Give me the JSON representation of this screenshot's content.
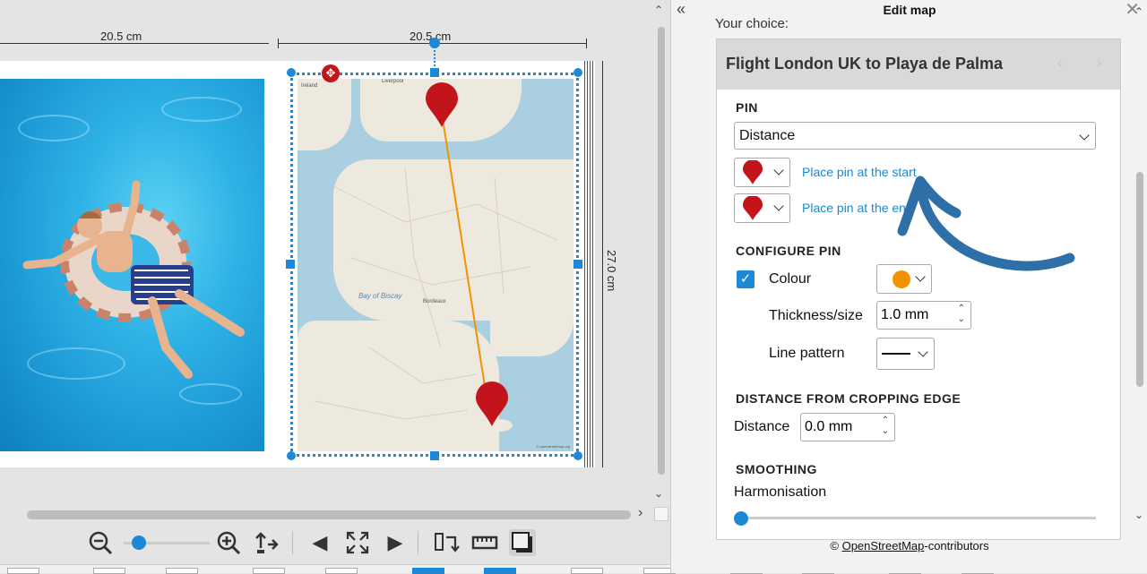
{
  "canvas": {
    "dim_left": "20.5 cm",
    "dim_right": "20.5 cm",
    "dim_height": "27.0 cm",
    "map_labels": [
      "Ireland",
      "Liverpool",
      "Bay of Biscay",
      "Bordeaux"
    ],
    "attribution_small": "© openstreetmap.org"
  },
  "toolbar": {
    "icons": [
      "zoom-out-icon",
      "zoom-in-icon",
      "fit-icon",
      "prev-page-icon",
      "fullscreen-icon",
      "next-page-icon",
      "swap-pages-icon",
      "ruler-icon",
      "shadow-icon"
    ],
    "zoom_level": 0.1
  },
  "panel": {
    "title": "Edit map",
    "collapse_icon": "double-chevron-left-icon",
    "close_icon": "close-icon",
    "your_choice": "Your choice:",
    "card_title": "Flight London UK to Playa de Palma",
    "pin_section": "PIN",
    "pin_mode": "Distance",
    "pin_start_link": "Place pin at the start",
    "pin_end_link": "Place pin at the en",
    "pin_color": "#c3131b",
    "configure_section": "CONFIGURE PIN",
    "colour_label": "Colour",
    "colour_checked": true,
    "colour_value": "#f39200",
    "thickness_label": "Thickness/size",
    "thickness_value": "1.0 mm",
    "line_pattern_label": "Line pattern",
    "distance_section": "DISTANCE FROM CROPPING EDGE",
    "distance_label": "Distance",
    "distance_value": "0.0 mm",
    "smoothing_section": "SMOOTHING",
    "harmonisation_label": "Harmonisation",
    "harmonisation_value": 0,
    "footer_prefix": "© ",
    "footer_link": "OpenStreetMap",
    "footer_suffix": "-contributors"
  },
  "colors": {
    "accent": "#1e88d8",
    "arrow": "#2e6fa8",
    "route": "#f39200"
  }
}
